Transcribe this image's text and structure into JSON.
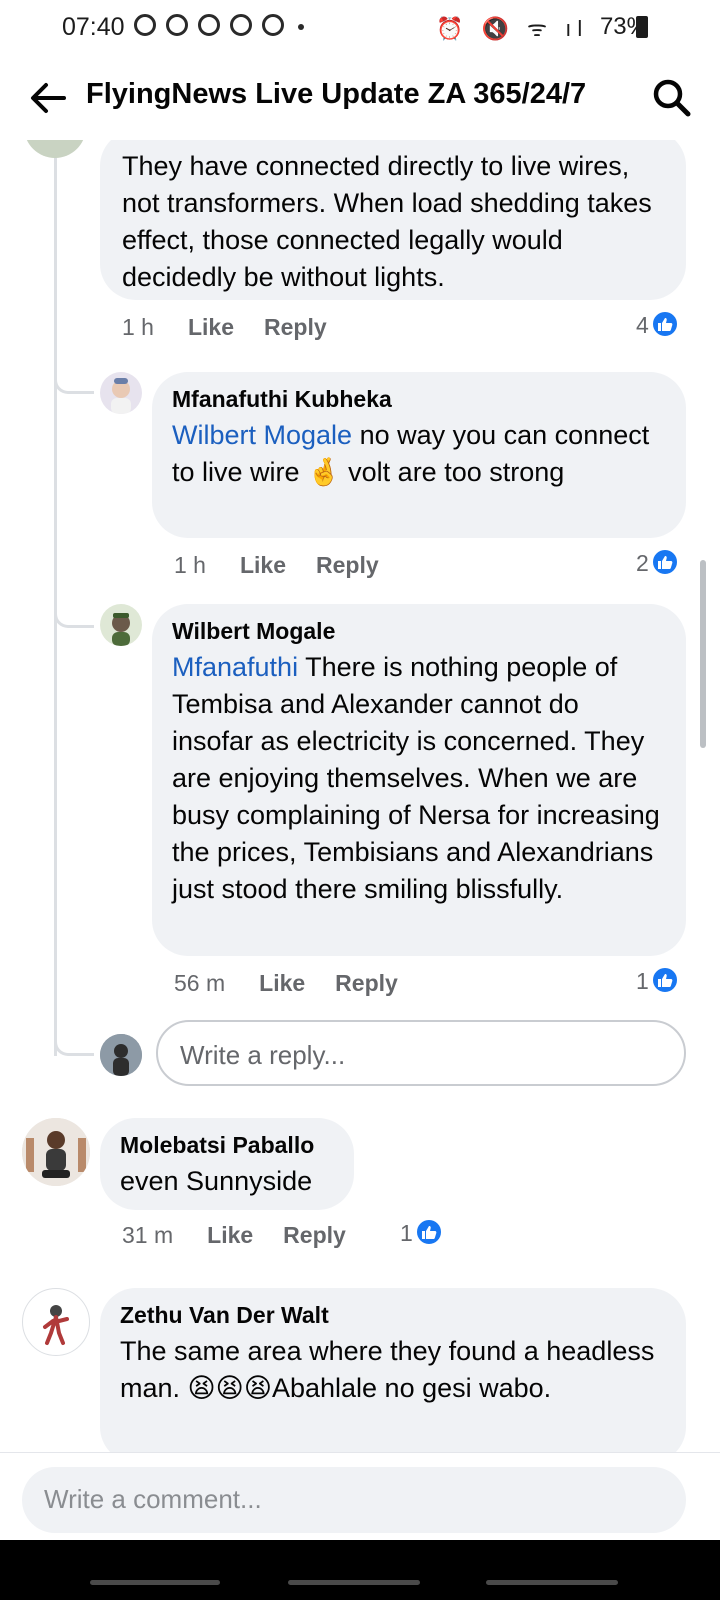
{
  "status_bar": {
    "time": "07:40",
    "battery": "73%"
  },
  "header": {
    "title": "FlyingNews Live Update ZA 365/24/7"
  },
  "comments": [
    {
      "text": "They have connected directly to live wires, not transformers. When load shedding takes effect, those connected legally would decidedly be without lights.",
      "time": "1 h",
      "like_label": "Like",
      "reply_label": "Reply",
      "reactions": "4"
    },
    {
      "name": "Mfanafuthi Kubheka",
      "mention": "Wilbert Mogale",
      "text": " no way you can connect to live wire 🤞 volt are too strong",
      "time": "1 h",
      "like_label": "Like",
      "reply_label": "Reply",
      "reactions": "2"
    },
    {
      "name": "Wilbert Mogale",
      "mention": "Mfanafuthi",
      "text": " There is nothing people of Tembisa and Alexander cannot do insofar as electricity is concerned. They are enjoying themselves. When we are busy complaining of Nersa for increasing the prices, Tembisians and Alexandrians just stood there smiling blissfully.",
      "time": "56 m",
      "like_label": "Like",
      "reply_label": "Reply",
      "reactions": "1"
    },
    {
      "name": "Molebatsi Paballo",
      "text": "even Sunnyside",
      "time": "31 m",
      "like_label": "Like",
      "reply_label": "Reply",
      "reactions": "1"
    },
    {
      "name": "Zethu Van Der Walt",
      "text": "The same area where they found a headless man. 😫😫😫Abahlale no gesi wabo."
    }
  ],
  "reply_box": {
    "placeholder": "Write a reply..."
  },
  "comment_bar": {
    "placeholder": "Write a comment..."
  },
  "icons": {
    "back": "back-arrow-icon",
    "search": "search-icon",
    "like": "like-thumb-icon"
  },
  "colors": {
    "like_blue": "#1877f2",
    "mention_blue": "#1b5fbf",
    "bubble_bg": "#f0f2f5"
  }
}
